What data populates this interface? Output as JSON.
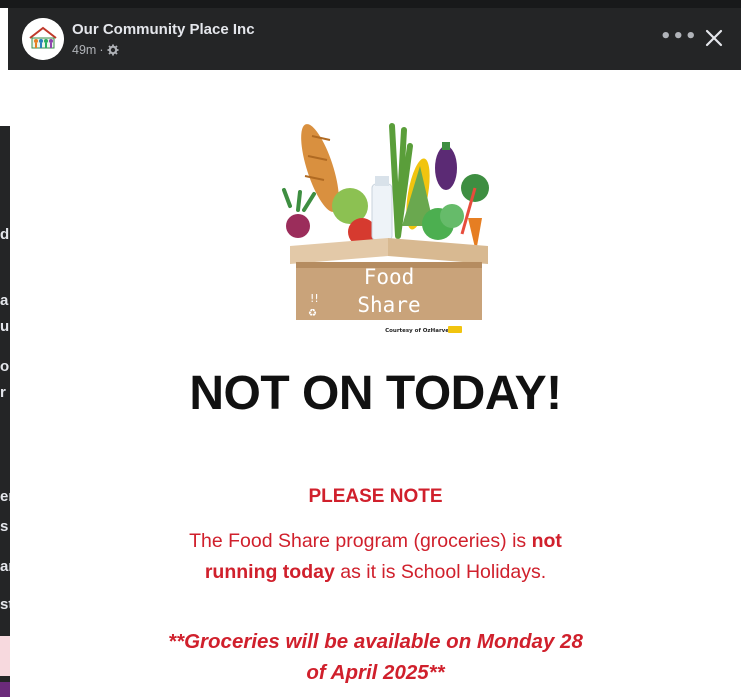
{
  "post": {
    "author": "Our Community Place Inc",
    "time": "49m",
    "more_label": "•••",
    "close_label": "Close"
  },
  "image": {
    "logo_word1": "Food",
    "logo_word2": "Share",
    "logo_credit": "Courtesy of OzHarvest",
    "headline": "NOT ON TODAY!",
    "note_title": "PLEASE NOTE",
    "body_part1": "The Food Share program (groceries) is ",
    "body_bold1": "not",
    "body_bold2": "running today",
    "body_part2": " as it is School Holidays.",
    "available_line1": "**Groceries will be available on Monday 28",
    "available_line2": "of April 2025**"
  },
  "background_page": {
    "letters": [
      "d",
      "a",
      "ul",
      "o",
      "r",
      "er",
      "s",
      "ar",
      "st"
    ]
  },
  "colors": {
    "header_bg": "#242526",
    "accent_red": "#d0202c",
    "headline": "#111111",
    "box": "#c9a37a"
  },
  "icons": {
    "privacy": "gear-icon",
    "more": "more-horizontal-icon",
    "close": "close-icon"
  }
}
